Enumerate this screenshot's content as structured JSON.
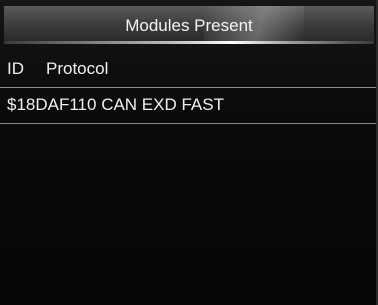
{
  "title": "Modules Present",
  "columns": {
    "id": "ID",
    "protocol": "Protocol"
  },
  "rows": [
    {
      "text": "$18DAF110 CAN EXD FAST"
    }
  ],
  "colors": {
    "background": "#060606",
    "title_bar": "#3e3e3e",
    "text": "#f0f0f0",
    "divider": "#8a8a8a"
  }
}
